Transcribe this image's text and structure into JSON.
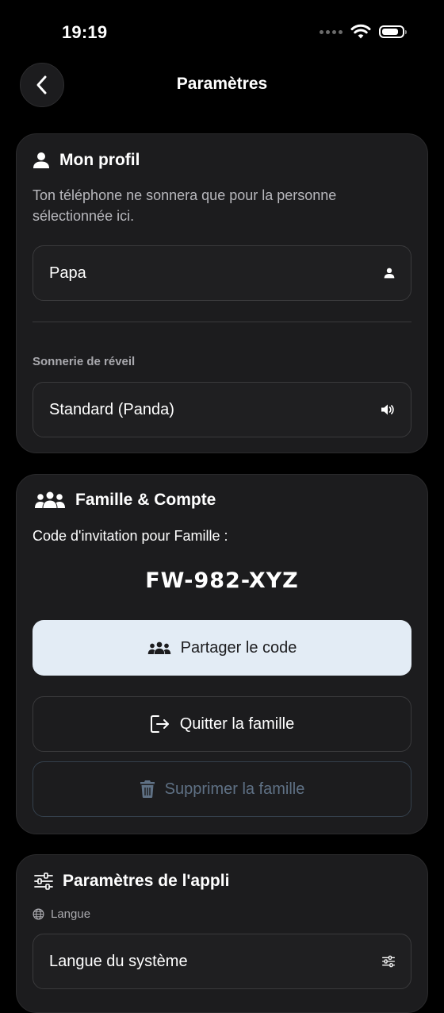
{
  "status_bar": {
    "time": "19:19",
    "battery_level": 0.85
  },
  "header": {
    "title": "Paramètres",
    "back_icon": "chevron-left-icon"
  },
  "profile": {
    "title": "Mon profil",
    "description": "Ton téléphone ne sonnera que pour la personne sélectionnée ici.",
    "name_value": "Papa",
    "ringtone_label": "Sonnerie de réveil",
    "ringtone_value": "Standard (Panda)"
  },
  "family": {
    "title": "Famille & Compte",
    "invite_label": "Code d'invitation pour Famille :",
    "invite_code": "FW-982-XYZ",
    "share_label": "Partager le code",
    "leave_label": "Quitter la famille",
    "delete_label": "Supprimer la famille"
  },
  "app_settings": {
    "title": "Paramètres de l'appli",
    "language_label": "Langue",
    "language_value": "Langue du système"
  },
  "colors": {
    "background": "#000000",
    "card": "#1c1c1e",
    "primary_button": "#e3ecf5",
    "danger_text": "#5f7185"
  }
}
